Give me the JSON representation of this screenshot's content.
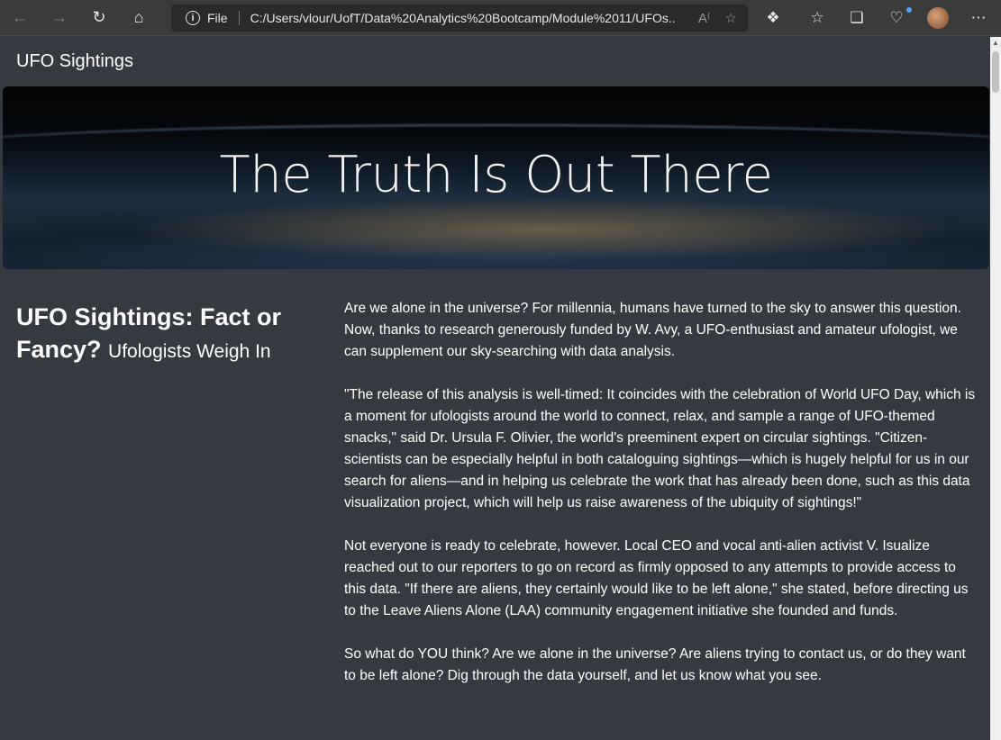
{
  "browser": {
    "file_label": "File",
    "url": "C:/Users/vlour/UofT/Data%20Analytics%20Bootcamp/Module%2011/UFOs..."
  },
  "navbar": {
    "brand": "UFO Sightings"
  },
  "hero": {
    "title": "The Truth Is Out There"
  },
  "sidebar": {
    "heading": "UFO Sightings: Fact or Fancy?",
    "subheading": "Ufologists Weigh In"
  },
  "article": {
    "paragraphs": [
      "Are we alone in the universe? For millennia, humans have turned to the sky to answer this question. Now, thanks to research generously funded by W. Avy, a UFO-enthusiast and amateur ufologist, we can supplement our sky-searching with data analysis.",
      "\"The release of this analysis is well-timed: It coincides with the celebration of World UFO Day, which is a moment for ufologists around the world to connect, relax, and sample a range of UFO-themed snacks,\" said Dr. Ursula F. Olivier, the world's preeminent expert on circular sightings. \"Citizen-scientists can be especially helpful in both cataloguing sightings—which is hugely helpful for us in our search for aliens—and in helping us celebrate the work that has already been done, such as this data visualization project, which will help us raise awareness of the ubiquity of sightings!\"",
      "Not everyone is ready to celebrate, however. Local CEO and vocal anti-alien activist V. Isualize reached out to our reporters to go on record as firmly opposed to any attempts to provide access to this data. \"If there are aliens, they certainly would like to be left alone,\" she stated, before directing us to the Leave Aliens Alone (LAA) community engagement initiative she founded and funds.",
      "So what do YOU think? Are we alone in the universe? Are aliens trying to contact us, or do they want to be left alone? Dig through the data yourself, and let us know what you see."
    ]
  },
  "icons": {
    "back": "arrow-left",
    "forward": "arrow-right",
    "refresh": "refresh",
    "home": "home",
    "info": "info-circle",
    "read_aloud": "read-aloud",
    "favorite_add": "star-plus",
    "extensions": "puzzle",
    "favorites": "star-list",
    "collections": "collections",
    "browser_essentials": "heart-shield",
    "menu": "ellipsis"
  },
  "colors": {
    "page_bg": "#343a40",
    "chrome_bg": "#3b3b3b",
    "text": "#ffffff"
  }
}
